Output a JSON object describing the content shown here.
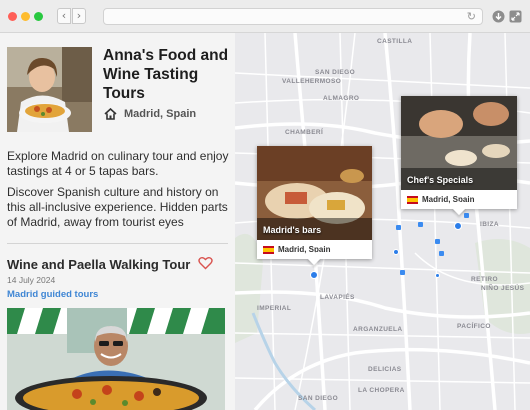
{
  "browser": {
    "back_icon": "chevron-left-icon",
    "forward_icon": "chevron-right-icon",
    "reload_icon": "reload-icon",
    "download_icon": "download-icon",
    "expand_icon": "expand-icon"
  },
  "tour": {
    "title_line1": "Anna's Food and",
    "title_line2": "Wine Tasting",
    "title_line3": "Tours",
    "location": "Madrid, Spain",
    "location_icon": "home-icon",
    "description_1": "Explore Madrid on culinary tour and enjoy tastings at 4 or 5 tapas bars.",
    "description_2": "Discover Spanish culture and history on this all-inclusive experience. Hidden parts of Madrid, away from tourist eyes"
  },
  "post": {
    "title": "Wine and Paella Walking Tour",
    "date": "14 July 2024",
    "tag": "Madrid guided tours",
    "favorite_icon": "heart-icon"
  },
  "map": {
    "streets": [
      "SAN DIEGO",
      "VALLEHERMOSO",
      "ALMAGRO",
      "CHAMBERÍ",
      "CASTILLA",
      "IBIZA",
      "RETIRO",
      "NIÑO JESÚS",
      "LAVAPIÉS",
      "IMPERIAL",
      "PACÍFICO",
      "ARGANZUELA",
      "DELICIAS",
      "LA CHOPERA",
      "SAN DIEGO"
    ],
    "cards": [
      {
        "title": "Madrid's bars",
        "location": "Madrid, Spain"
      },
      {
        "title": "Chef's Specials",
        "location": "Madrid, Spain"
      }
    ]
  },
  "colors": {
    "accent_link": "#3f86d4",
    "marker": "#2b7de9",
    "heart": "#d9534f"
  }
}
